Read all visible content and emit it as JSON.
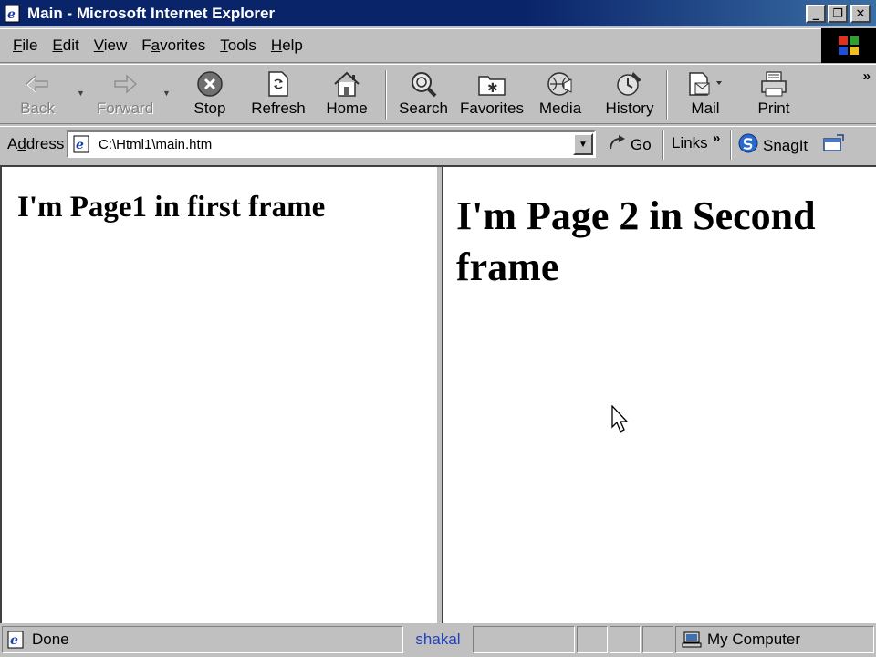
{
  "window": {
    "title": "Main - Microsoft Internet Explorer",
    "buttons": {
      "minimize": "_",
      "maximize": "❐",
      "close": "✕"
    }
  },
  "menu": {
    "items": [
      {
        "accel": "F",
        "rest": "ile"
      },
      {
        "accel": "E",
        "rest": "dit"
      },
      {
        "accel": "V",
        "rest": "iew"
      },
      {
        "pre": "F",
        "accel": "a",
        "rest": "vorites"
      },
      {
        "accel": "T",
        "rest": "ools"
      },
      {
        "accel": "H",
        "rest": "elp"
      }
    ]
  },
  "toolbar": {
    "back": "Back",
    "forward": "Forward",
    "stop": "Stop",
    "refresh": "Refresh",
    "home": "Home",
    "search": "Search",
    "favorites": "Favorites",
    "media": "Media",
    "history": "History",
    "mail": "Mail",
    "print": "Print",
    "more": "»"
  },
  "address": {
    "label_accel": "d",
    "label_pre": "A",
    "label_rest": "dress",
    "url": "C:\\Html1\\main.htm",
    "go": "Go",
    "links": "Links",
    "links_more": "»",
    "snagit": "SnagIt"
  },
  "frames": {
    "first_heading": "I'm Page1 in first frame",
    "second_heading": "I'm Page 2 in Second frame"
  },
  "status": {
    "text": "Done",
    "center": "shakal",
    "zone": "My Computer"
  }
}
